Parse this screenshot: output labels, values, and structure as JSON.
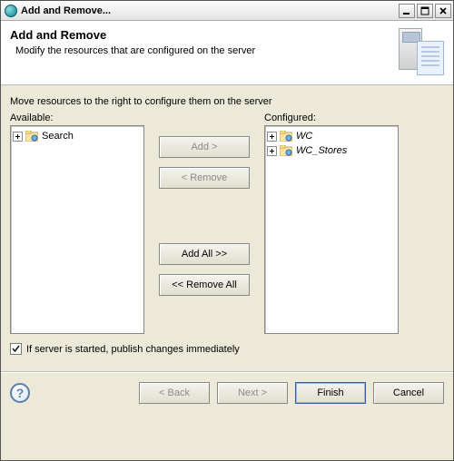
{
  "window": {
    "title": "Add and Remove..."
  },
  "header": {
    "title": "Add and Remove",
    "subtitle": "Modify the resources that are configured on the server"
  },
  "body": {
    "instruction": "Move resources to the right to configure them on the server",
    "available_label": "Available:",
    "configured_label": "Configured:",
    "available_items": [
      {
        "label": "Search"
      }
    ],
    "configured_items": [
      {
        "label": "WC"
      },
      {
        "label": "WC_Stores"
      }
    ],
    "buttons": {
      "add": "Add >",
      "remove": "< Remove",
      "add_all": "Add All >>",
      "remove_all": "<< Remove All"
    },
    "checkbox": {
      "checked": true,
      "label": "If server is started, publish changes immediately"
    }
  },
  "footer": {
    "back": "< Back",
    "next": "Next >",
    "finish": "Finish",
    "cancel": "Cancel"
  }
}
